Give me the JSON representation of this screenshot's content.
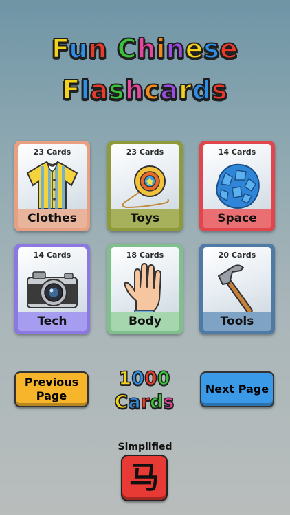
{
  "title": {
    "line1": "Fun Chinese",
    "line2": "Flashcards",
    "colors": [
      "#f2d21c",
      "#2f8fe6",
      "#e83b2b",
      "#3cc13c",
      "#e6479d",
      "#f28a1b",
      "#9a4ce0"
    ]
  },
  "cards": [
    {
      "count": "23 Cards",
      "label": "Clothes",
      "icon": "shirt-icon",
      "frame": "#e8a082",
      "band": "#e8b49c"
    },
    {
      "count": "23 Cards",
      "label": "Toys",
      "icon": "yoyo-icon",
      "frame": "#8f9a3a",
      "band": "#a7b05a"
    },
    {
      "count": "14 Cards",
      "label": "Space",
      "icon": "asteroid-icon",
      "frame": "#e0464b",
      "band": "#ea6f72"
    },
    {
      "count": "14 Cards",
      "label": "Tech",
      "icon": "camera-icon",
      "frame": "#8b78e0",
      "band": "#a79df0"
    },
    {
      "count": "18 Cards",
      "label": "Body",
      "icon": "hand-icon",
      "frame": "#7fc08c",
      "band": "#a6d6ad"
    },
    {
      "count": "20 Cards",
      "label": "Tools",
      "icon": "hammer-icon",
      "frame": "#4f7aa6",
      "band": "#7fa3c4"
    }
  ],
  "nav": {
    "prev_label": "Previous Page",
    "next_label": "Next Page",
    "prev_color": "#f6b52a",
    "next_color": "#3a9ae8"
  },
  "counter": {
    "line1": "1000",
    "line2": "Cards"
  },
  "script": {
    "label": "Simplified",
    "glyph": "马",
    "color": "#e83a34"
  }
}
